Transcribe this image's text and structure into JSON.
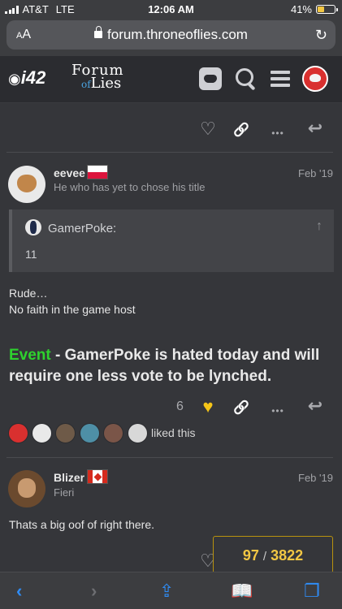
{
  "status_bar": {
    "carrier": "AT&T",
    "network": "LTE",
    "time": "12:06 AM",
    "battery": "41%"
  },
  "url_bar": {
    "aa_label_big": "A",
    "aa_label_small": "A",
    "url": "forum.throneoflies.com",
    "reload_glyph": "↻"
  },
  "header": {
    "brand_i42": "i42",
    "brand_line1": "Forum",
    "brand_of": "of",
    "brand_line2": "Lies"
  },
  "post1": {
    "username": "eevee",
    "user_title": "He who has yet to chose his title",
    "date": "Feb '19",
    "quote_user": "GamerPoke:",
    "quote_arrow": "↑",
    "quote_text": "11",
    "line1": "Rude…",
    "line2": "No faith in the game host",
    "event_label": "Event",
    "event_text": " - GamerPoke is hated today and will require one less vote to be lynched.",
    "like_count": "6",
    "liked_text": "liked this"
  },
  "post2": {
    "username": "Blizer",
    "user_title": "Fieri",
    "date": "Feb '19",
    "body": "Thats a big oof of right there."
  },
  "progress": {
    "current": "97",
    "separator": "/",
    "total": "3822"
  },
  "colors": {
    "event_green": "#2ed12e",
    "like_gold": "#f5c518",
    "ios_blue": "#2f8cf5",
    "badge_border": "#b8920e"
  }
}
